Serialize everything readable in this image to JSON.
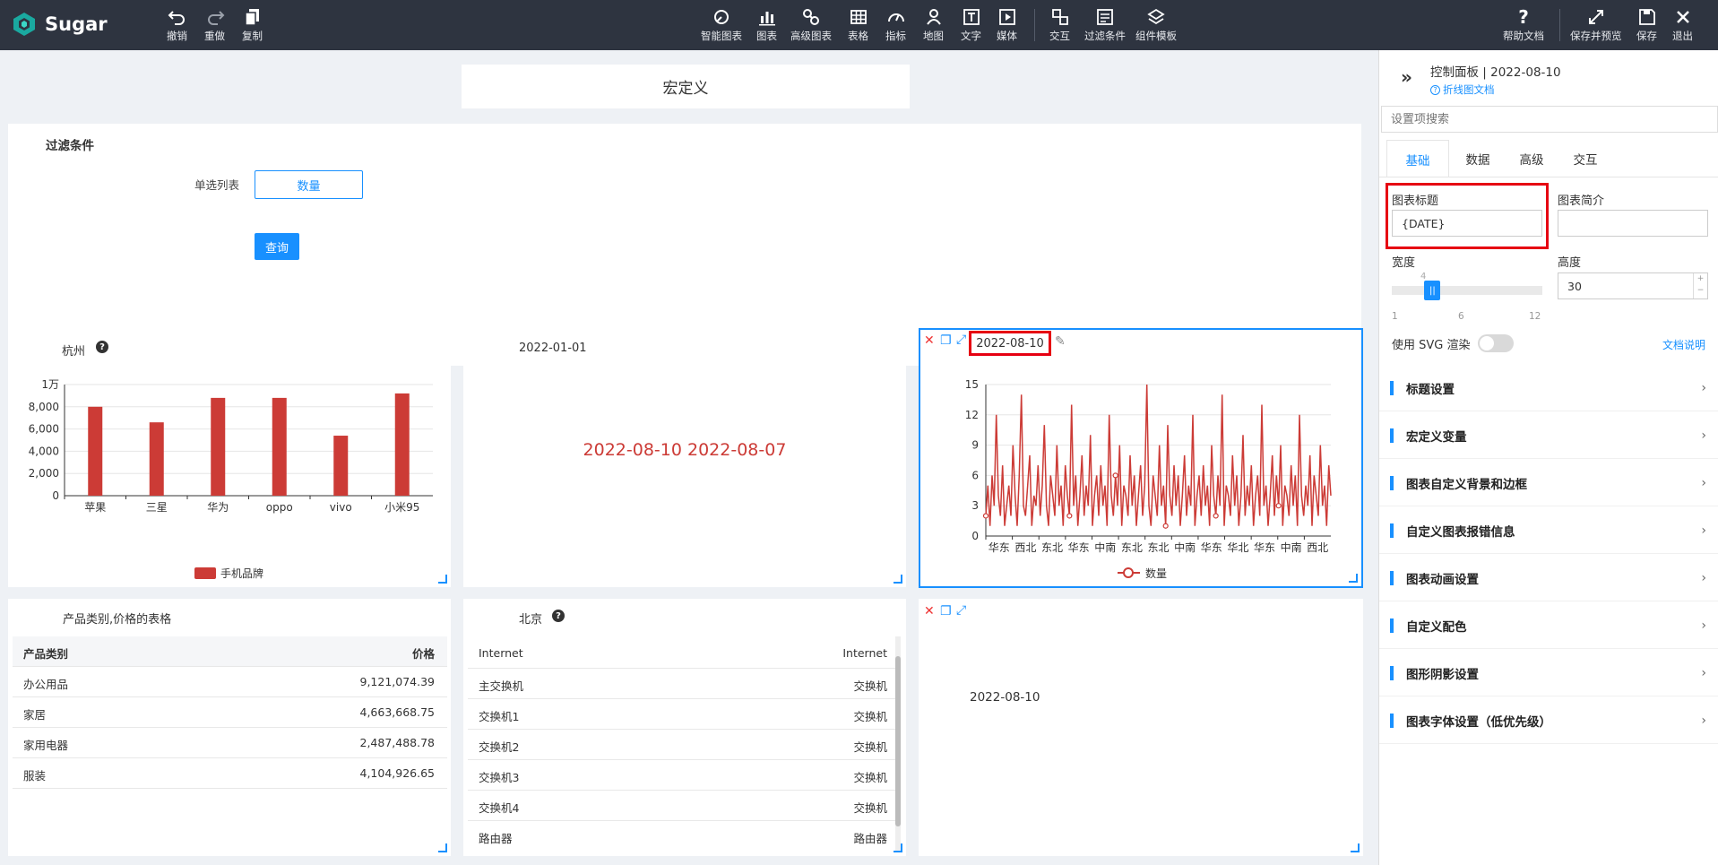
{
  "app": {
    "name": "Sugar"
  },
  "toolbar": {
    "left": [
      {
        "label": "撤销",
        "icon": "undo-icon"
      },
      {
        "label": "重做",
        "icon": "redo-icon"
      },
      {
        "label": "复制",
        "icon": "copy-icon"
      }
    ],
    "center": [
      {
        "label": "智能图表",
        "icon": "smart-chart-icon"
      },
      {
        "label": "图表",
        "icon": "bar-chart-icon"
      },
      {
        "label": "高级图表",
        "icon": "advanced-chart-icon"
      },
      {
        "label": "表格",
        "icon": "table-icon"
      },
      {
        "label": "指标",
        "icon": "gauge-icon"
      },
      {
        "label": "地图",
        "icon": "map-pin-icon"
      },
      {
        "label": "文字",
        "icon": "text-icon"
      },
      {
        "label": "媒体",
        "icon": "media-icon"
      },
      {
        "label": "交互",
        "icon": "interaction-icon"
      },
      {
        "label": "过滤条件",
        "icon": "filter-icon"
      },
      {
        "label": "组件模板",
        "icon": "template-icon"
      }
    ],
    "right": [
      {
        "label": "帮助文档",
        "icon": "help-icon"
      },
      {
        "label": "保存并预览",
        "icon": "expand-icon"
      },
      {
        "label": "保存",
        "icon": "save-icon"
      },
      {
        "label": "退出",
        "icon": "close-icon"
      }
    ]
  },
  "macro_title": "宏定义",
  "filter_card": {
    "title": "过滤条件",
    "field_label": "单选列表",
    "select_value": "数量",
    "query_button": "查询"
  },
  "hangzhou_card": {
    "title": "杭州"
  },
  "date_card": {
    "title": "2022-01-01",
    "content": "2022-08-10 2022-08-07"
  },
  "line_card": {
    "title": "2022-08-10"
  },
  "product_table": {
    "title": "产品类别,价格的表格",
    "headers": [
      "产品类别",
      "价格"
    ],
    "rows": [
      [
        "办公用品",
        "9,121,074.39"
      ],
      [
        "家居",
        "4,663,668.75"
      ],
      [
        "家用电器",
        "2,487,488.78"
      ],
      [
        "服装",
        "4,104,926.65"
      ]
    ]
  },
  "beijing_table": {
    "title": "北京",
    "headers": [
      "Internet",
      "Internet"
    ],
    "rows": [
      [
        "主交换机",
        "交换机"
      ],
      [
        "交换机1",
        "交换机"
      ],
      [
        "交换机2",
        "交换机"
      ],
      [
        "交换机3",
        "交换机"
      ],
      [
        "交换机4",
        "交换机"
      ],
      [
        "路由器",
        "路由器"
      ]
    ]
  },
  "text_card": {
    "content": "2022-08-10"
  },
  "chart_data": [
    {
      "type": "bar",
      "categories": [
        "苹果",
        "三星",
        "华为",
        "oppo",
        "vivo",
        "小米95"
      ],
      "values": [
        8000,
        6600,
        8800,
        8800,
        5400,
        9200
      ],
      "ylim": [
        0,
        10000
      ],
      "yticks": [
        "0",
        "2,000",
        "4,000",
        "6,000",
        "8,000",
        "1万"
      ],
      "series": [
        {
          "name": "手机品牌",
          "values": [
            8000,
            6600,
            8800,
            8800,
            5400,
            9200
          ]
        }
      ],
      "legend": "bottom-center",
      "grid": true,
      "color": "#cc3b36"
    },
    {
      "type": "line",
      "title": "2022-08-10",
      "xticks": [
        "华东",
        "西北",
        "东北",
        "华东",
        "中南",
        "东北",
        "东北",
        "中南",
        "华东",
        "华北",
        "华东",
        "中南",
        "西北"
      ],
      "ylim": [
        0,
        15
      ],
      "yticks": [
        "0",
        "3",
        "6",
        "9",
        "12",
        "15"
      ],
      "series": [
        {
          "name": "数量",
          "values": [
            2,
            5,
            1,
            6,
            3,
            12,
            4,
            2,
            7,
            1,
            3,
            5,
            2,
            9,
            4,
            1,
            6,
            14,
            3,
            2,
            5,
            8,
            1,
            4,
            3,
            7,
            2,
            5,
            11,
            3,
            1,
            6,
            4,
            2,
            9,
            3,
            5,
            1,
            7,
            4,
            2,
            13,
            3,
            6,
            1,
            4,
            8,
            2,
            5,
            3,
            10,
            1,
            4,
            6,
            2,
            7,
            3,
            5,
            1,
            12,
            4,
            2,
            6,
            3,
            9,
            1,
            5,
            4,
            2,
            8,
            3,
            6,
            1,
            4,
            7,
            2,
            5,
            15,
            3,
            1,
            6,
            4,
            2,
            9,
            3,
            5,
            1,
            11,
            4,
            2,
            7,
            3,
            6,
            1,
            4,
            8,
            2,
            5,
            3,
            12,
            1,
            4,
            6,
            2,
            7,
            3,
            5,
            1,
            9,
            4,
            2,
            6,
            3,
            14,
            1,
            5,
            4,
            2,
            8,
            3,
            6,
            1,
            4,
            10,
            2,
            5,
            3,
            7,
            1,
            4,
            6,
            2,
            13,
            3,
            5,
            1,
            4,
            8,
            2,
            6,
            3,
            9,
            1,
            5,
            4,
            2,
            7,
            3,
            6,
            1,
            12,
            4,
            2,
            5,
            3,
            8,
            1,
            6,
            4,
            2,
            9,
            3,
            5,
            1,
            7,
            4
          ]
        }
      ],
      "legend": "bottom-center",
      "grid": true,
      "color": "#cc3b36"
    }
  ],
  "panel": {
    "title": "控制面板 | 2022-08-10",
    "doc_link": "折线图文档",
    "search_placeholder": "设置项搜索",
    "tabs": [
      "基础",
      "数据",
      "高级",
      "交互"
    ],
    "chart_title_label": "图表标题",
    "chart_title_value": "{DATE}",
    "chart_desc_label": "图表简介",
    "width_label": "宽度",
    "width_value": "4",
    "width_min": "1",
    "width_mid": "6",
    "width_max": "12",
    "width_fraction": 0.27,
    "height_label": "高度",
    "height_value": "30",
    "svg_label": "使用 SVG 渲染",
    "svg_doc": "文档说明",
    "categories": [
      "标题设置",
      "宏定义变量",
      "图表自定义背景和边框",
      "自定义图表报错信息",
      "图表动画设置",
      "自定义配色",
      "图形阴影设置",
      "图表字体设置（低优先级）"
    ]
  }
}
